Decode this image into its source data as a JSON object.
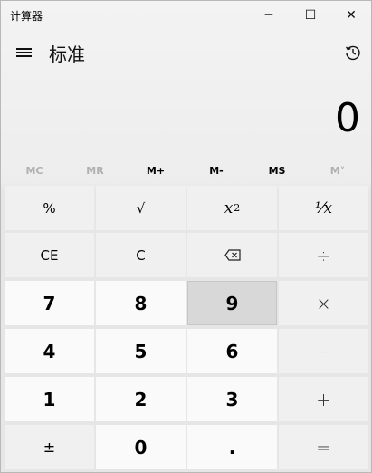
{
  "window": {
    "title": "计算器",
    "controls": {
      "minimize": "─",
      "maximize": "☐",
      "close": "✕"
    }
  },
  "header": {
    "mode_title": "标准",
    "menu_icon": "hamburger-icon",
    "history_icon": "history-icon"
  },
  "display": {
    "value": "0"
  },
  "memory": [
    {
      "label": "MC",
      "enabled": false
    },
    {
      "label": "MR",
      "enabled": false
    },
    {
      "label": "M+",
      "enabled": true
    },
    {
      "label": "M-",
      "enabled": true
    },
    {
      "label": "MS",
      "enabled": true
    },
    {
      "label": "M˅",
      "enabled": false
    }
  ],
  "keys": {
    "percent": "%",
    "sqrt": "√",
    "square_base": "x",
    "square_exp": "2",
    "reciprocal": "⅟x",
    "ce": "CE",
    "c": "C",
    "divide": "÷",
    "seven": "7",
    "eight": "8",
    "nine": "9",
    "multiply": "×",
    "four": "4",
    "five": "5",
    "six": "6",
    "minus": "−",
    "one": "1",
    "two": "2",
    "three": "3",
    "plus": "+",
    "negate": "±",
    "zero": "0",
    "decimal": ".",
    "equals": "="
  },
  "colors": {
    "op_key_bg": "#f0f0f0",
    "num_key_bg": "#fafafa",
    "selected_key_bg": "#d8d8d8",
    "disabled_text": "#b0b0b0"
  }
}
